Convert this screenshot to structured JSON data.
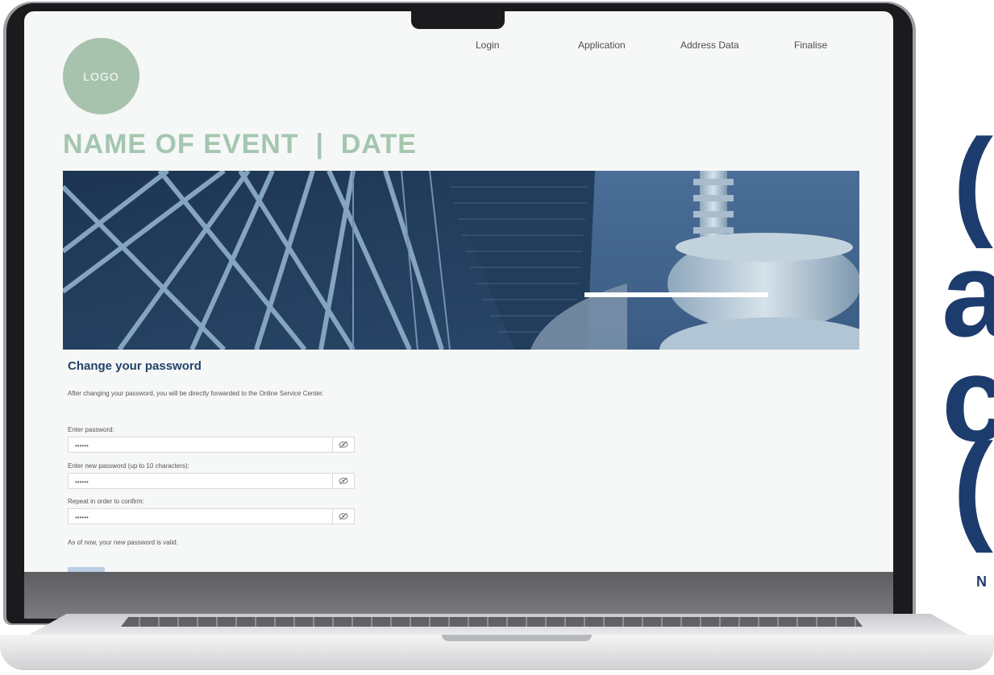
{
  "window": {
    "logo_text": "LOGO",
    "event_title": "NAME OF EVENT  |  DATE"
  },
  "nav": {
    "items": [
      "Login",
      "Application",
      "Address Data",
      "Finalise"
    ]
  },
  "form": {
    "title": "Change your password",
    "intro": "After changing your password, you will be directly forwarded to the Online Service Center.",
    "fields": [
      {
        "label": "Enter password:",
        "value": "••••••"
      },
      {
        "label": "Enter new password (up to 10 characters):",
        "value": "••••••"
      },
      {
        "label": "Repeat in order to confirm:",
        "value": "••••••"
      }
    ],
    "note": "As of now, your new password is valid."
  },
  "side_text": {
    "glyph_1": "(",
    "glyph_2": "a",
    "glyph_3": "c",
    "glyph_4": "(",
    "small": "N"
  },
  "colors": {
    "logo_green": "#a7c3ad",
    "title_green": "#a4c6af",
    "heading_blue": "#23436a",
    "side_blue": "#1d3c6e"
  },
  "icons": [
    "eye-slash-icon"
  ]
}
